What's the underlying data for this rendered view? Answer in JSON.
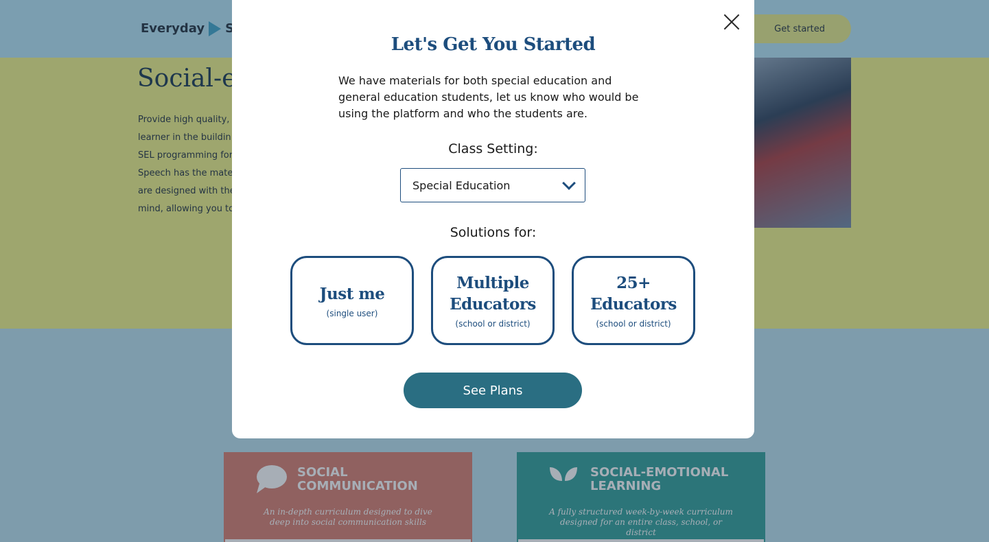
{
  "header": {
    "logo_text": "Everyday",
    "logo_text_cut": "Spe",
    "cta_label": "Get started"
  },
  "hero": {
    "title": "Social-em",
    "body_lines": [
      "Provide high quality, e",
      "learner in the buildin",
      "SEL programming for",
      "Speech has the mate",
      "are designed with the",
      "mind, allowing you to"
    ]
  },
  "cards": [
    {
      "title_line1": "SOCIAL",
      "title_line2": "COMMUNICATION",
      "subtitle": "An in-depth curriculum designed to dive deep into social communication skills",
      "icon": "speech-bubble-icon"
    },
    {
      "title_line1": "SOCIAL-EMOTIONAL",
      "title_line2": "LEARNING",
      "subtitle": "A fully structured week-by-week curriculum designed for an entire class, school, or district",
      "icon": "sprout-icon"
    }
  ],
  "modal": {
    "title": "Let's Get You Started",
    "intro": "We have materials for both special education and general education students, let us know who would be using the platform and who the students are.",
    "class_setting_label": "Class Setting:",
    "class_setting_value": "Special Education",
    "solutions_label": "Solutions for:",
    "options": [
      {
        "title": "Just me",
        "subtitle": "(single user)"
      },
      {
        "title": "Multiple Educators",
        "subtitle": "(school or district)"
      },
      {
        "title": "25+ Educators",
        "subtitle": "(school or district)"
      }
    ],
    "submit_label": "See Plans"
  },
  "colors": {
    "header_bg": "#b3e3f5",
    "hero_bg": "#eff184",
    "accent_navy": "#1d4d7d",
    "button_teal": "#2a6e82",
    "card_social_communication": "#d77b6b",
    "card_sel": "#2b9d96"
  }
}
